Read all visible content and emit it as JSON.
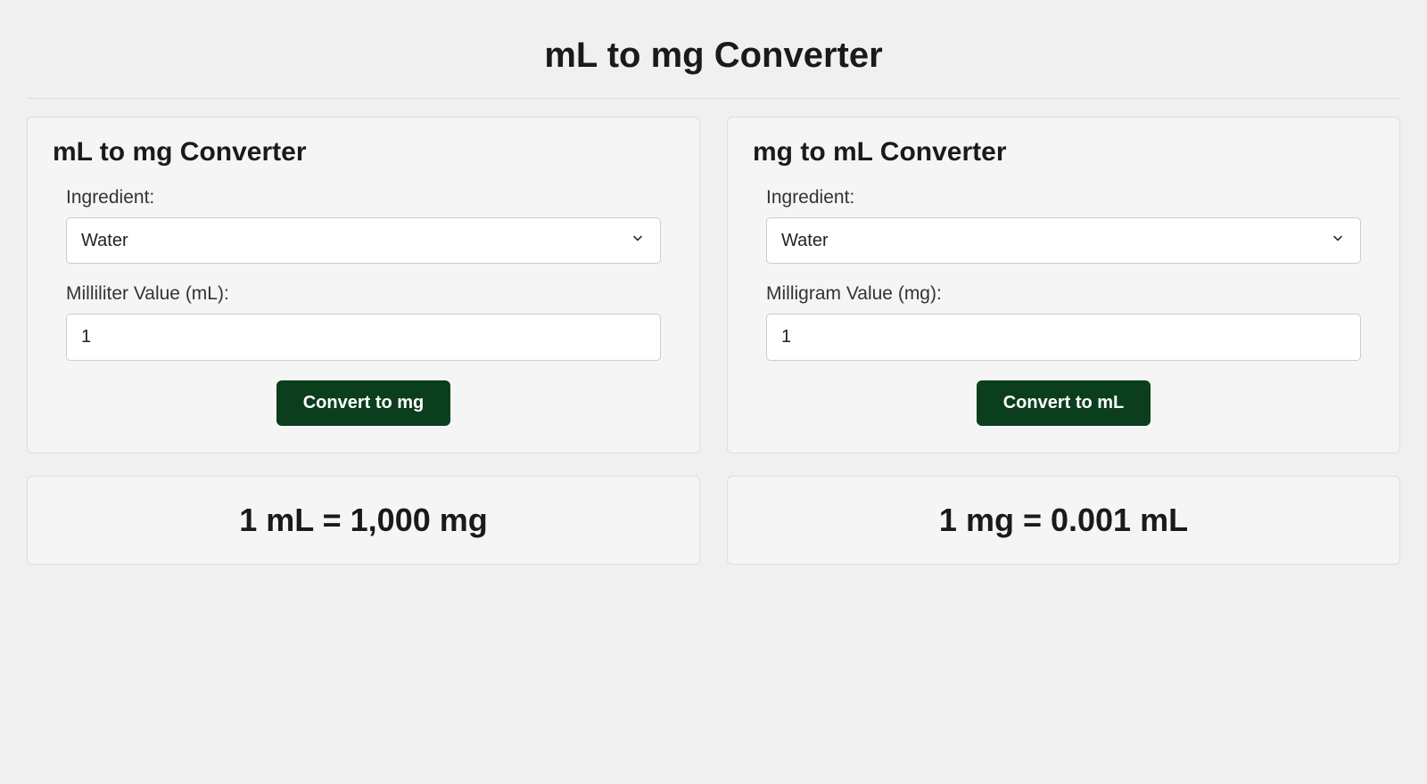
{
  "pageTitle": "mL to mg Converter",
  "left": {
    "title": "mL to mg Converter",
    "ingredientLabel": "Ingredient:",
    "ingredientValue": "Water",
    "valueLabel": "Milliliter Value (mL):",
    "valueInput": "1",
    "buttonLabel": "Convert to mg",
    "result": "1 mL = 1,000 mg"
  },
  "right": {
    "title": "mg to mL Converter",
    "ingredientLabel": "Ingredient:",
    "ingredientValue": "Water",
    "valueLabel": "Milligram Value (mg):",
    "valueInput": "1",
    "buttonLabel": "Convert to mL",
    "result": "1 mg = 0.001 mL"
  }
}
